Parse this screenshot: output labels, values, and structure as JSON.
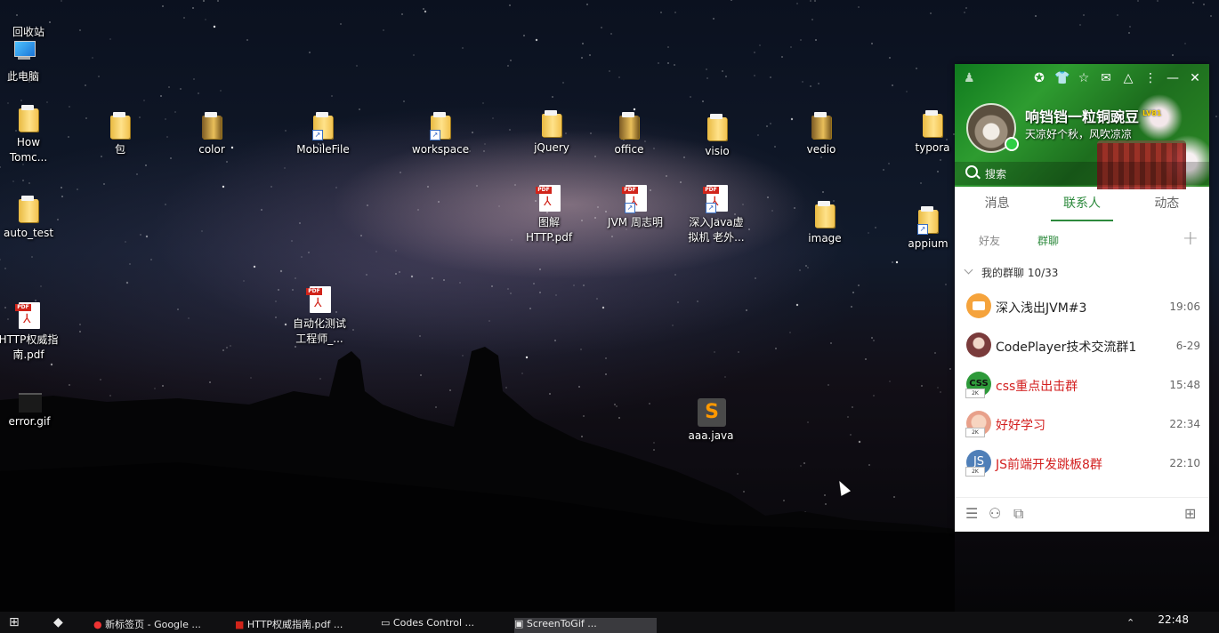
{
  "desktop": {
    "icons": {
      "recycle": "回收站",
      "computer": "此电脑",
      "how_tomcat": "How\nTomc...",
      "bao": "包",
      "color": "color",
      "mobilefile": "MobileFile",
      "workspace": "workspace",
      "jquery": "jQuery",
      "office": "office",
      "visio": "visio",
      "vedio": "vedio",
      "typora": "typora",
      "auto_test": "auto_test",
      "tujie_http": "图解\nHTTP.pdf",
      "jvm": "JVM 周志明",
      "java_vm": "深入Java虚\n拟机 老外...",
      "image": "image",
      "appium": "appium",
      "http_guide": "HTTP权威指\n南.pdf",
      "auto_test_engineer": "自动化测试\n工程师_...",
      "error_gif": "error.gif",
      "aaa_java": "aaa.java"
    }
  },
  "qq": {
    "nickname": "响铛铛一粒铜豌豆",
    "level": "LV81",
    "signature": "天凉好个秋，风吹凉凉",
    "search_placeholder": "搜索",
    "tabs": [
      "消息",
      "联系人",
      "动态"
    ],
    "subtabs": [
      "好友",
      "群聊"
    ],
    "group_header": "我的群聊  10/33",
    "groups": [
      {
        "name": "深入浅出JVM#3",
        "time": "19:06",
        "red": false,
        "color": "#f5a33c"
      },
      {
        "name": "CodePlayer技术交流群1",
        "time": "6-29",
        "red": false,
        "color": "#7a3b3b"
      },
      {
        "name": "css重点出击群",
        "time": "15:48",
        "red": true,
        "color": "#2e9a3a"
      },
      {
        "name": "好好学习",
        "time": "22:34",
        "red": true,
        "color": "#e8a08a"
      },
      {
        "name": "JS前端开发跳板8群",
        "time": "22:10",
        "red": true,
        "color": "#4f7fb8"
      }
    ]
  },
  "taskbar": {
    "items": [
      "新标签页 - Google ...",
      "HTTP权威指南.pdf ...",
      "Codes Control ...",
      "ScreenToGif ..."
    ],
    "clock": "22:48"
  }
}
